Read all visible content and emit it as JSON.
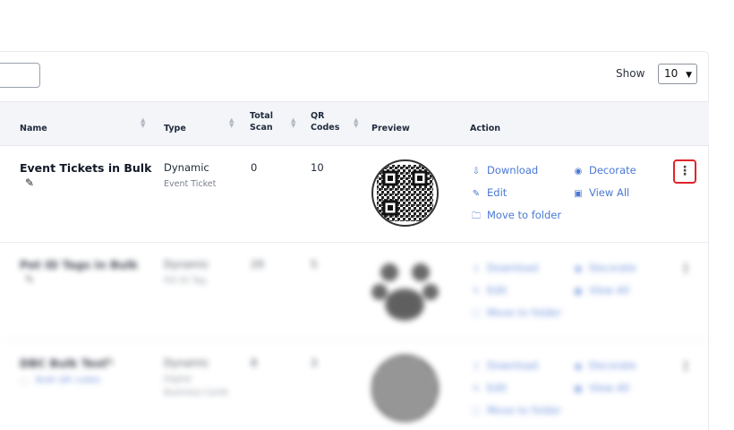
{
  "toolbar": {
    "show_label": "Show",
    "page_size": "10"
  },
  "table": {
    "headers": {
      "name": "Name",
      "type": "Type",
      "total_scan": [
        "Total",
        "Scan"
      ],
      "qr_codes": [
        "QR",
        "Codes"
      ],
      "preview": "Preview",
      "action": "Action"
    },
    "rows": [
      {
        "name": "Event Tickets in Bulk",
        "type": "Dynamic",
        "subtype": [
          "Event Ticket"
        ],
        "total_scan": "0",
        "qr_codes": "10",
        "actions": {
          "download": "Download",
          "decorate": "Decorate",
          "edit": "Edit",
          "view_all": "View All",
          "move": "Move to folder"
        }
      },
      {
        "name": "Pet ID Tags in Bulk",
        "type": "Dynamic",
        "subtype": [
          "Pet ID Tag"
        ],
        "total_scan": "29",
        "qr_codes": "5",
        "actions": {
          "download": "Download",
          "decorate": "Decorate",
          "edit": "Edit",
          "view_all": "View All",
          "move": "Move to folder"
        }
      },
      {
        "name": "DBC Bulk Test",
        "type": "Dynamic",
        "subtype": [
          "Digital",
          "Business Cards"
        ],
        "total_scan": "8",
        "qr_codes": "3",
        "folder_link": "Bulk QR codes",
        "actions": {
          "download": "Download",
          "decorate": "Decorate",
          "edit": "Edit",
          "view_all": "View All",
          "move": "Move to folder"
        }
      }
    ]
  },
  "colors": {
    "accent": "#4a78d4",
    "highlight": "#e0242b"
  }
}
